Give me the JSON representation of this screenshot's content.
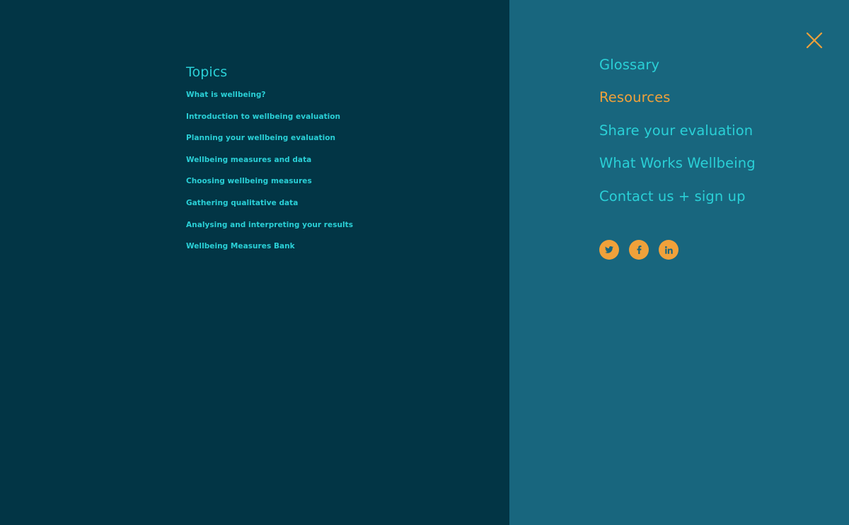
{
  "topics": {
    "title": "Topics",
    "items": [
      {
        "label": "What is wellbeing?"
      },
      {
        "label": "Introduction to wellbeing evaluation"
      },
      {
        "label": "Planning your wellbeing evaluation"
      },
      {
        "label": "Wellbeing measures and data"
      },
      {
        "label": "Choosing wellbeing measures"
      },
      {
        "label": "Gathering qualitative data"
      },
      {
        "label": "Analysing and interpreting your results"
      },
      {
        "label": "Wellbeing Measures Bank"
      }
    ]
  },
  "main_nav": {
    "items": [
      {
        "label": "Glossary",
        "active": false
      },
      {
        "label": "Resources",
        "active": true
      },
      {
        "label": "Share your evaluation",
        "active": false
      },
      {
        "label": "What Works Wellbeing",
        "active": false
      },
      {
        "label": "Contact us + sign up",
        "active": false
      }
    ]
  },
  "social": {
    "icons": [
      "twitter-icon",
      "facebook-icon",
      "linkedin-icon"
    ]
  },
  "close_icon": "close-icon",
  "colors": {
    "left_bg": "#023545",
    "right_bg": "#18667e",
    "accent": "#2ad0d7",
    "highlight": "#f0a13a"
  }
}
